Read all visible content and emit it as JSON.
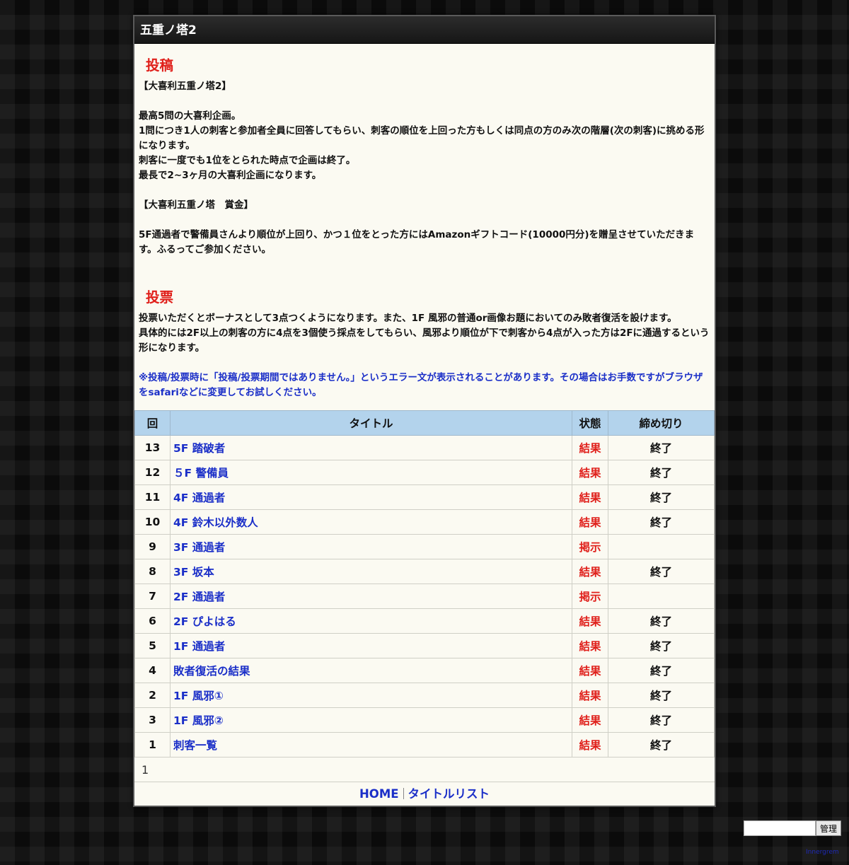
{
  "window": {
    "title": "五重ノ塔2"
  },
  "post_section": {
    "heading": "投稿",
    "lines": [
      "【大喜利五重ノ塔2】",
      "",
      "最高5問の大喜利企画。",
      "1問につき1人の刺客と参加者全員に回答してもらい、刺客の順位を上回った方もしくは同点の方のみ次の階層(次の刺客)に挑める形になります。",
      "刺客に一度でも1位をとられた時点で企画は終了。",
      "最長で2~3ヶ月の大喜利企画になります。",
      "",
      "【大喜利五重ノ塔　賞金】",
      "",
      "5F通過者で警備員さんより順位が上回り、かつ１位をとった方にはAmazonギフトコード(10000円分)を贈呈させていただきます。ふるってご参加ください。"
    ]
  },
  "vote_section": {
    "heading": "投票",
    "lines": [
      "投票いただくとボーナスとして3点つくようになります。また、1F 風邪の普通or画像お題においてのみ敗者復活を設けます。",
      "具体的には2F以上の刺客の方に4点を3個使う採点をしてもらい、風邪より順位が下で刺客から4点が入った方は2Fに通過するという形になります。"
    ],
    "note": "※投稿/投票時に「投稿/投票期間ではありません。」というエラー文が表示されることがあります。その場合はお手数ですがブラウザをsafariなどに変更してお試しください。"
  },
  "table": {
    "headers": {
      "no": "回",
      "title": "タイトル",
      "status": "状態",
      "deadline": "締め切り"
    },
    "rows": [
      {
        "no": "13",
        "title": "5F 踏破者",
        "status": "結果",
        "deadline": "終了"
      },
      {
        "no": "12",
        "title": "５F 警備員",
        "status": "結果",
        "deadline": "終了"
      },
      {
        "no": "11",
        "title": "4F 通過者",
        "status": "結果",
        "deadline": "終了"
      },
      {
        "no": "10",
        "title": "4F 鈴木以外数人",
        "status": "結果",
        "deadline": "終了"
      },
      {
        "no": "9",
        "title": "3F 通過者",
        "status": "掲示",
        "deadline": ""
      },
      {
        "no": "8",
        "title": "3F 坂本",
        "status": "結果",
        "deadline": "終了"
      },
      {
        "no": "7",
        "title": "2F 通過者",
        "status": "掲示",
        "deadline": ""
      },
      {
        "no": "6",
        "title": "2F ぴよはる",
        "status": "結果",
        "deadline": "終了"
      },
      {
        "no": "5",
        "title": "1F 通過者",
        "status": "結果",
        "deadline": "終了"
      },
      {
        "no": "4",
        "title": "敗者復活の結果",
        "status": "結果",
        "deadline": "終了"
      },
      {
        "no": "2",
        "title": "1F 風邪①",
        "status": "結果",
        "deadline": "終了"
      },
      {
        "no": "3",
        "title": "1F 風邪②",
        "status": "結果",
        "deadline": "終了"
      },
      {
        "no": "1",
        "title": "刺客一覧",
        "status": "結果",
        "deadline": "終了"
      }
    ]
  },
  "pagination": {
    "current": "1"
  },
  "footer": {
    "home": "HOME",
    "title_list": "タイトルリスト"
  },
  "admin": {
    "input_value": "",
    "button_label": "管理"
  },
  "credit": {
    "text": "Innergrem"
  },
  "colors": {
    "accent_red": "#e0201b",
    "link_blue": "#1b2fc8",
    "table_header": "#b3d3ec"
  }
}
